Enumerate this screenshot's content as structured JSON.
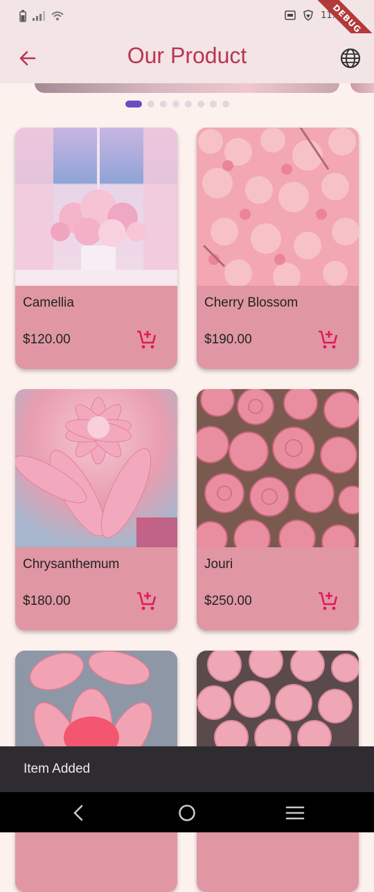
{
  "status_bar": {
    "time": "11:",
    "debug_label": "DEBUG"
  },
  "app_bar": {
    "title": "Our Product"
  },
  "carousel": {
    "total_pages": 8,
    "active_index": 0
  },
  "colors": {
    "accent": "#b8354f",
    "cart_icon": "#e0195a",
    "card_background": "#e097a3",
    "active_dot": "#6a4cbf"
  },
  "products": [
    {
      "name": "Camellia",
      "price": "$120.00"
    },
    {
      "name": "Cherry Blossom",
      "price": "$190.00"
    },
    {
      "name": "Chrysanthemum",
      "price": "$180.00"
    },
    {
      "name": "Jouri",
      "price": "$250.00"
    },
    {
      "name": "",
      "price": ""
    },
    {
      "name": "",
      "price": ""
    }
  ],
  "snackbar": {
    "message": "Item Added"
  },
  "icons": {
    "back": "arrow-left-icon",
    "language": "globe-icon",
    "cart": "add-shopping-cart-icon",
    "nav_back": "chevron-left-icon",
    "nav_home": "circle-home-icon",
    "nav_menu": "menu-lines-icon"
  }
}
